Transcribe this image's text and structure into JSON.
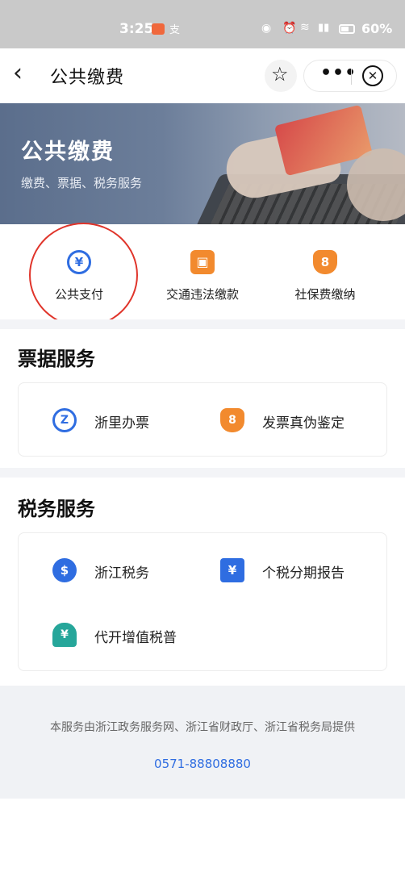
{
  "status_bar": {
    "time": "3:25",
    "battery": "60%",
    "alipay_mark": "支"
  },
  "navbar": {
    "back_icon": "chevron-left-icon",
    "title": "公共缴费",
    "favorite_icon": "star-outline-icon",
    "more_icon": "more-dots-icon",
    "close_icon": "close-circle-icon",
    "more_glyph": "•••",
    "close_glyph": "✕"
  },
  "banner": {
    "title": "公共缴费",
    "subtitle": "缴费、票据、税务服务"
  },
  "quick_actions": [
    {
      "label": "公共支付",
      "icon": "yen-circle-icon",
      "glyph": "¥",
      "highlighted": true
    },
    {
      "label": "交通违法缴款",
      "icon": "car-icon",
      "glyph": "🚗"
    },
    {
      "label": "社保费缴纳",
      "icon": "shield-person-icon",
      "glyph": "8"
    }
  ],
  "sections": [
    {
      "title": "票据服务",
      "items": [
        {
          "label": "浙里办票",
          "icon": "zheli-logo-icon",
          "glyph": "Z"
        },
        {
          "label": "发票真伪鉴定",
          "icon": "shield-person-icon",
          "glyph": "8"
        }
      ]
    },
    {
      "title": "税务服务",
      "items": [
        {
          "label": "浙江税务",
          "icon": "tax-hand-icon",
          "glyph": "$"
        },
        {
          "label": "个税分期报告",
          "icon": "yen-ticket-icon",
          "glyph": "¥"
        },
        {
          "label": "代开增值税普",
          "icon": "house-yen-icon",
          "glyph": "¥"
        }
      ]
    }
  ],
  "footer": {
    "text": "本服务由浙江政务服务网、浙江省财政厅、浙江省税务局提供",
    "phone": "0571-88808880"
  },
  "colors": {
    "accent_blue": "#2f6de1",
    "accent_orange": "#f28a2e",
    "annotation_red": "#e0352b"
  }
}
